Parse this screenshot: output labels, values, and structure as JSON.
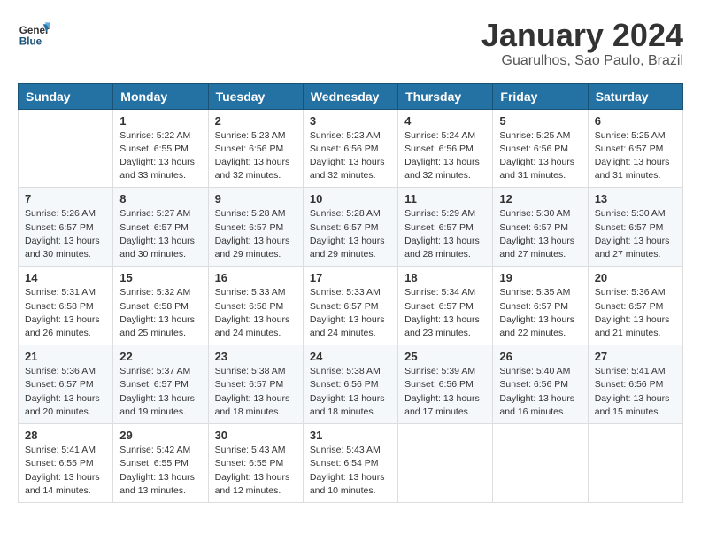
{
  "header": {
    "logo_line1": "General",
    "logo_line2": "Blue",
    "main_title": "January 2024",
    "subtitle": "Guarulhos, Sao Paulo, Brazil"
  },
  "days_of_week": [
    "Sunday",
    "Monday",
    "Tuesday",
    "Wednesday",
    "Thursday",
    "Friday",
    "Saturday"
  ],
  "weeks": [
    [
      {
        "num": "",
        "info": ""
      },
      {
        "num": "1",
        "info": "Sunrise: 5:22 AM\nSunset: 6:55 PM\nDaylight: 13 hours\nand 33 minutes."
      },
      {
        "num": "2",
        "info": "Sunrise: 5:23 AM\nSunset: 6:56 PM\nDaylight: 13 hours\nand 32 minutes."
      },
      {
        "num": "3",
        "info": "Sunrise: 5:23 AM\nSunset: 6:56 PM\nDaylight: 13 hours\nand 32 minutes."
      },
      {
        "num": "4",
        "info": "Sunrise: 5:24 AM\nSunset: 6:56 PM\nDaylight: 13 hours\nand 32 minutes."
      },
      {
        "num": "5",
        "info": "Sunrise: 5:25 AM\nSunset: 6:56 PM\nDaylight: 13 hours\nand 31 minutes."
      },
      {
        "num": "6",
        "info": "Sunrise: 5:25 AM\nSunset: 6:57 PM\nDaylight: 13 hours\nand 31 minutes."
      }
    ],
    [
      {
        "num": "7",
        "info": "Sunrise: 5:26 AM\nSunset: 6:57 PM\nDaylight: 13 hours\nand 30 minutes."
      },
      {
        "num": "8",
        "info": "Sunrise: 5:27 AM\nSunset: 6:57 PM\nDaylight: 13 hours\nand 30 minutes."
      },
      {
        "num": "9",
        "info": "Sunrise: 5:28 AM\nSunset: 6:57 PM\nDaylight: 13 hours\nand 29 minutes."
      },
      {
        "num": "10",
        "info": "Sunrise: 5:28 AM\nSunset: 6:57 PM\nDaylight: 13 hours\nand 29 minutes."
      },
      {
        "num": "11",
        "info": "Sunrise: 5:29 AM\nSunset: 6:57 PM\nDaylight: 13 hours\nand 28 minutes."
      },
      {
        "num": "12",
        "info": "Sunrise: 5:30 AM\nSunset: 6:57 PM\nDaylight: 13 hours\nand 27 minutes."
      },
      {
        "num": "13",
        "info": "Sunrise: 5:30 AM\nSunset: 6:57 PM\nDaylight: 13 hours\nand 27 minutes."
      }
    ],
    [
      {
        "num": "14",
        "info": "Sunrise: 5:31 AM\nSunset: 6:58 PM\nDaylight: 13 hours\nand 26 minutes."
      },
      {
        "num": "15",
        "info": "Sunrise: 5:32 AM\nSunset: 6:58 PM\nDaylight: 13 hours\nand 25 minutes."
      },
      {
        "num": "16",
        "info": "Sunrise: 5:33 AM\nSunset: 6:58 PM\nDaylight: 13 hours\nand 24 minutes."
      },
      {
        "num": "17",
        "info": "Sunrise: 5:33 AM\nSunset: 6:57 PM\nDaylight: 13 hours\nand 24 minutes."
      },
      {
        "num": "18",
        "info": "Sunrise: 5:34 AM\nSunset: 6:57 PM\nDaylight: 13 hours\nand 23 minutes."
      },
      {
        "num": "19",
        "info": "Sunrise: 5:35 AM\nSunset: 6:57 PM\nDaylight: 13 hours\nand 22 minutes."
      },
      {
        "num": "20",
        "info": "Sunrise: 5:36 AM\nSunset: 6:57 PM\nDaylight: 13 hours\nand 21 minutes."
      }
    ],
    [
      {
        "num": "21",
        "info": "Sunrise: 5:36 AM\nSunset: 6:57 PM\nDaylight: 13 hours\nand 20 minutes."
      },
      {
        "num": "22",
        "info": "Sunrise: 5:37 AM\nSunset: 6:57 PM\nDaylight: 13 hours\nand 19 minutes."
      },
      {
        "num": "23",
        "info": "Sunrise: 5:38 AM\nSunset: 6:57 PM\nDaylight: 13 hours\nand 18 minutes."
      },
      {
        "num": "24",
        "info": "Sunrise: 5:38 AM\nSunset: 6:56 PM\nDaylight: 13 hours\nand 18 minutes."
      },
      {
        "num": "25",
        "info": "Sunrise: 5:39 AM\nSunset: 6:56 PM\nDaylight: 13 hours\nand 17 minutes."
      },
      {
        "num": "26",
        "info": "Sunrise: 5:40 AM\nSunset: 6:56 PM\nDaylight: 13 hours\nand 16 minutes."
      },
      {
        "num": "27",
        "info": "Sunrise: 5:41 AM\nSunset: 6:56 PM\nDaylight: 13 hours\nand 15 minutes."
      }
    ],
    [
      {
        "num": "28",
        "info": "Sunrise: 5:41 AM\nSunset: 6:55 PM\nDaylight: 13 hours\nand 14 minutes."
      },
      {
        "num": "29",
        "info": "Sunrise: 5:42 AM\nSunset: 6:55 PM\nDaylight: 13 hours\nand 13 minutes."
      },
      {
        "num": "30",
        "info": "Sunrise: 5:43 AM\nSunset: 6:55 PM\nDaylight: 13 hours\nand 12 minutes."
      },
      {
        "num": "31",
        "info": "Sunrise: 5:43 AM\nSunset: 6:54 PM\nDaylight: 13 hours\nand 10 minutes."
      },
      {
        "num": "",
        "info": ""
      },
      {
        "num": "",
        "info": ""
      },
      {
        "num": "",
        "info": ""
      }
    ]
  ]
}
